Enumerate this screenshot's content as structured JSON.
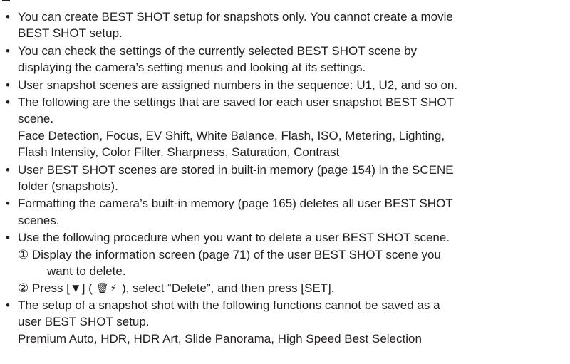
{
  "bullet_glyph": "•",
  "notes": [
    {
      "lines": [
        "You can create BEST SHOT setup for snapshots only. You cannot create a movie",
        "BEST SHOT setup."
      ]
    },
    {
      "lines": [
        "You can check the settings of the currently selected BEST SHOT scene by",
        "displaying the camera’s setting menus and looking at its settings."
      ]
    },
    {
      "lines": [
        "User snapshot scenes are assigned numbers in the sequence: U1, U2, and so on."
      ]
    },
    {
      "lines": [
        "The following are the settings that are saved for each user snapshot BEST SHOT",
        "scene.",
        "Face Detection, Focus, EV Shift, White Balance, Flash, ISO, Metering, Lighting,",
        "Flash Intensity, Color Filter, Sharpness, Saturation, Contrast"
      ]
    },
    {
      "lines": [
        "User BEST SHOT scenes are stored in built-in memory (page 154) in the SCENE",
        "folder (snapshots)."
      ]
    },
    {
      "lines": [
        "Formatting the camera’s built-in memory (page 165) deletes all user BEST SHOT",
        "scenes."
      ]
    },
    {
      "lines": [
        "Use the following procedure when you want to delete a user BEST SHOT scene."
      ],
      "step1": {
        "number": "①",
        "line1": "Display the information screen (page 71) of the user BEST SHOT scene you",
        "line2": "want to delete."
      },
      "step2": {
        "number": "②",
        "text_before": "Press [▼] (",
        "trash_icon": "🗑",
        "flash_icon": "⚡",
        "text_after": "), select “Delete”, and then press [SET]."
      }
    },
    {
      "lines": [
        "The setup of a snapshot shot with the following functions cannot be saved as a",
        "user BEST SHOT setup.",
        "Premium Auto, HDR, HDR Art, Slide Panorama, High Speed Best Selection"
      ]
    }
  ]
}
